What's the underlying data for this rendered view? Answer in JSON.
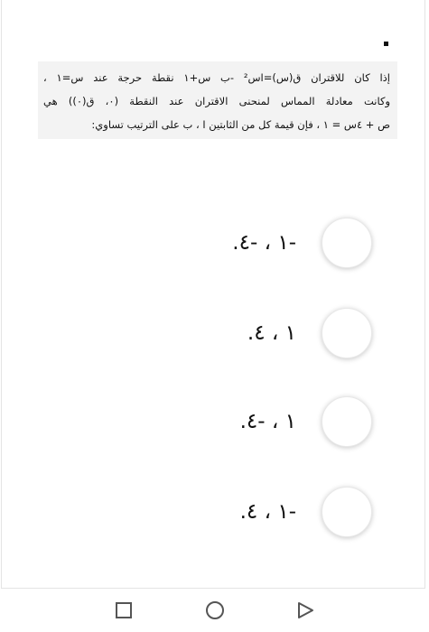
{
  "question": {
    "lines": [
      "إذا كان للاقتران ق(س)=اس² -ب س+١ نقطة حرجة عند س=١ ،",
      "وكانت معادلة المماس لمنحنى الاقتران عند النقطة (٠، ق(٠)) هي",
      "ص + ٤س = ١ ، فإن قيمة كل من الثابتين ا ، ب على الترتيب تساوي:"
    ]
  },
  "options": [
    {
      "text": "-١ ، -٤."
    },
    {
      "text": "١ ، ٤."
    },
    {
      "text": "١ ، -٤."
    },
    {
      "text": "-١ ، ٤."
    }
  ],
  "navbar": {
    "recents_icon": "square-icon",
    "home_icon": "circle-icon",
    "back_icon": "triangle-icon"
  }
}
